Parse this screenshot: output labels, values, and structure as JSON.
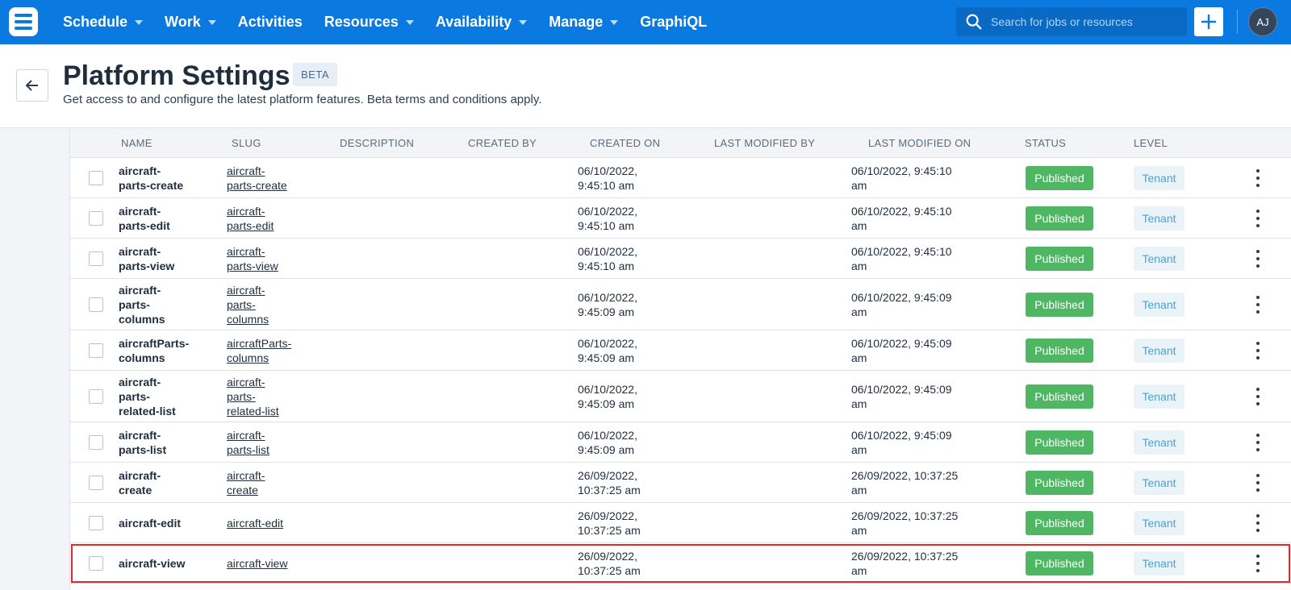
{
  "nav": {
    "items": [
      {
        "label": "Schedule",
        "dropdown": true
      },
      {
        "label": "Work",
        "dropdown": true
      },
      {
        "label": "Activities",
        "dropdown": false
      },
      {
        "label": "Resources",
        "dropdown": true
      },
      {
        "label": "Availability",
        "dropdown": true
      },
      {
        "label": "Manage",
        "dropdown": true
      },
      {
        "label": "GraphiQL",
        "dropdown": false
      }
    ],
    "search_placeholder": "Search for jobs or resources",
    "avatar_initials": "AJ"
  },
  "header": {
    "title": "Platform Settings",
    "badge": "BETA",
    "subtitle": "Get access to and configure the latest platform features. Beta terms and conditions apply."
  },
  "table": {
    "columns": [
      "NAME",
      "SLUG",
      "DESCRIPTION",
      "CREATED BY",
      "CREATED ON",
      "LAST MODIFIED BY",
      "LAST MODIFIED ON",
      "STATUS",
      "LEVEL"
    ],
    "rows": [
      {
        "name": [
          "aircraft-",
          "parts-create"
        ],
        "slug": [
          "aircraft-",
          "parts-create"
        ],
        "created_on": [
          "06/10/2022,",
          "9:45:10 am"
        ],
        "modified_on": [
          "06/10/2022, 9:45:10",
          "am"
        ],
        "status": "Published",
        "level": "Tenant"
      },
      {
        "name": [
          "aircraft-",
          "parts-edit"
        ],
        "slug": [
          "aircraft-",
          "parts-edit"
        ],
        "created_on": [
          "06/10/2022,",
          "9:45:10 am"
        ],
        "modified_on": [
          "06/10/2022, 9:45:10",
          "am"
        ],
        "status": "Published",
        "level": "Tenant"
      },
      {
        "name": [
          "aircraft-",
          "parts-view"
        ],
        "slug": [
          "aircraft-",
          "parts-view"
        ],
        "created_on": [
          "06/10/2022,",
          "9:45:10 am"
        ],
        "modified_on": [
          "06/10/2022, 9:45:10",
          "am"
        ],
        "status": "Published",
        "level": "Tenant"
      },
      {
        "name": [
          "aircraft-",
          "parts-",
          "columns"
        ],
        "slug": [
          "aircraft-",
          "parts-",
          "columns"
        ],
        "created_on": [
          "06/10/2022,",
          "9:45:09 am"
        ],
        "modified_on": [
          "06/10/2022, 9:45:09",
          "am"
        ],
        "status": "Published",
        "level": "Tenant"
      },
      {
        "name": [
          "aircraftParts-",
          "columns"
        ],
        "slug": [
          "aircraftParts-",
          "columns"
        ],
        "created_on": [
          "06/10/2022,",
          "9:45:09 am"
        ],
        "modified_on": [
          "06/10/2022, 9:45:09",
          "am"
        ],
        "status": "Published",
        "level": "Tenant"
      },
      {
        "name": [
          "aircraft-",
          "parts-",
          "related-list"
        ],
        "slug": [
          "aircraft-",
          "parts-",
          "related-list"
        ],
        "created_on": [
          "06/10/2022,",
          "9:45:09 am"
        ],
        "modified_on": [
          "06/10/2022, 9:45:09",
          "am"
        ],
        "status": "Published",
        "level": "Tenant"
      },
      {
        "name": [
          "aircraft-",
          "parts-list"
        ],
        "slug": [
          "aircraft-",
          "parts-list"
        ],
        "created_on": [
          "06/10/2022,",
          "9:45:09 am"
        ],
        "modified_on": [
          "06/10/2022, 9:45:09",
          "am"
        ],
        "status": "Published",
        "level": "Tenant"
      },
      {
        "name": [
          "aircraft-",
          "create"
        ],
        "slug": [
          "aircraft-",
          "create"
        ],
        "created_on": [
          "26/09/2022,",
          "10:37:25 am"
        ],
        "modified_on": [
          "26/09/2022, 10:37:25",
          "am"
        ],
        "status": "Published",
        "level": "Tenant"
      },
      {
        "name": [
          "aircraft-edit"
        ],
        "slug": [
          "aircraft-edit"
        ],
        "created_on": [
          "26/09/2022,",
          "10:37:25 am"
        ],
        "modified_on": [
          "26/09/2022, 10:37:25",
          "am"
        ],
        "status": "Published",
        "level": "Tenant"
      },
      {
        "name": [
          "aircraft-view"
        ],
        "slug": [
          "aircraft-view"
        ],
        "created_on": [
          "26/09/2022,",
          "10:37:25 am"
        ],
        "modified_on": [
          "26/09/2022, 10:37:25",
          "am"
        ],
        "status": "Published",
        "level": "Tenant",
        "highlighted": true
      }
    ]
  },
  "colors": {
    "nav_bg": "#0b7ae0",
    "status_published": "#4fb764",
    "level_tenant_text": "#45a3d8",
    "highlight": "#e22a2a"
  }
}
